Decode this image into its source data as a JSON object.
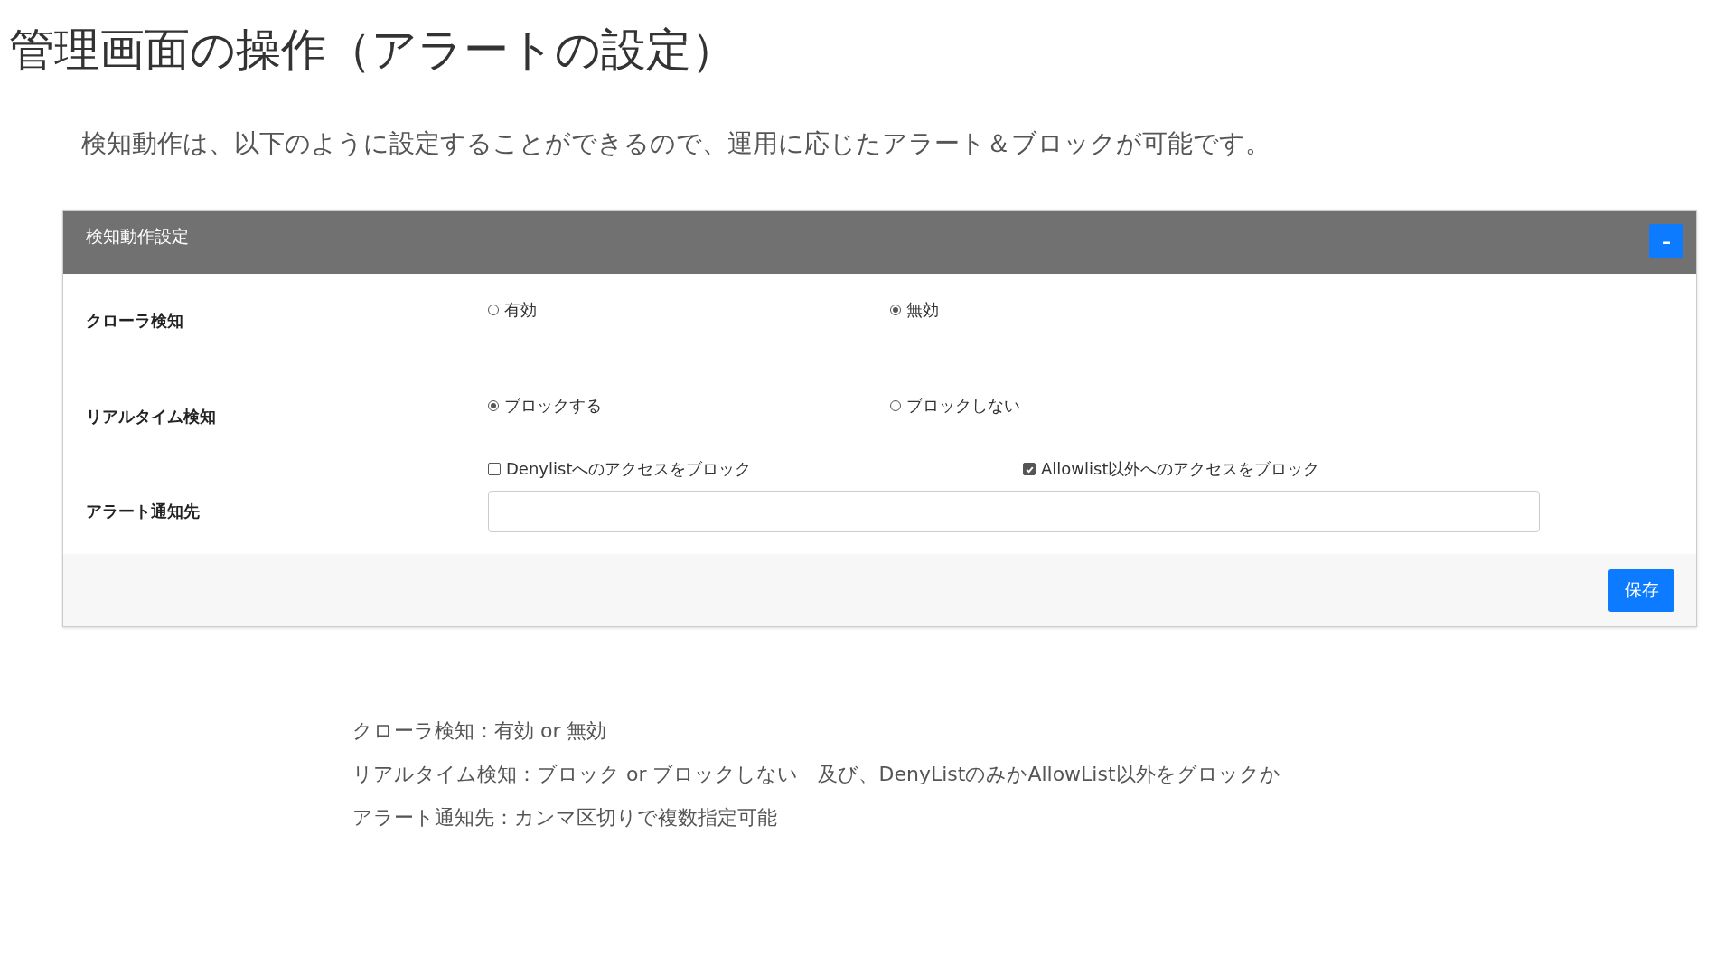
{
  "title": "管理画面の操作（アラートの設定）",
  "lead": "検知動作は、以下のように設定することができるので、運用に応じたアラート＆ブロックが可能です。",
  "panel": {
    "title": "検知動作設定",
    "collapse_button": "–",
    "rows": [
      {
        "kind": "radio",
        "label": "クローラ検知",
        "options": [
          {
            "label": "有効",
            "selected": false
          },
          {
            "label": "無効",
            "selected": true
          }
        ]
      },
      {
        "kind": "radio",
        "label": "リアルタイム検知",
        "options": [
          {
            "label": "ブロックする",
            "selected": true
          },
          {
            "label": "ブロックしない",
            "selected": false
          }
        ]
      },
      {
        "kind": "checkbox",
        "options": [
          {
            "label": "Denylistへのアクセスをブロック",
            "checked": false
          },
          {
            "label": "Allowlist以外へのアクセスをブロック",
            "checked": true
          }
        ]
      },
      {
        "kind": "text",
        "label": "アラート通知先"
      }
    ],
    "save_button": "保存"
  },
  "notes": [
    "クローラ検知：有効 or 無効",
    "リアルタイム検知：ブロック or ブロックしない　及び、DenyListのみかAllowList以外をグロックか",
    "アラート通知先：カンマ区切りで複数指定可能"
  ]
}
